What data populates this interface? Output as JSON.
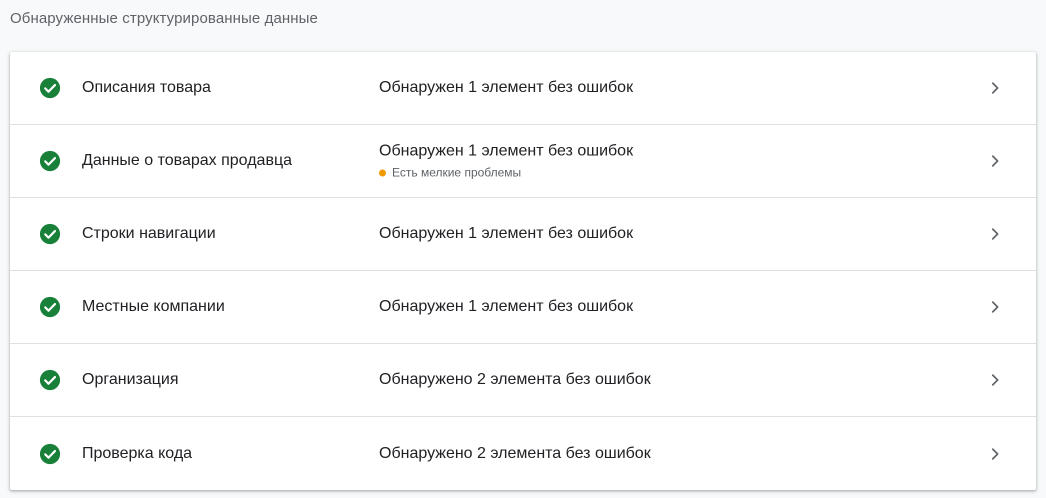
{
  "section": {
    "title": "Обнаруженные структурированные данные"
  },
  "colors": {
    "check": "#188038",
    "warning": "#f29900",
    "chevron": "#5f6368"
  },
  "items": [
    {
      "icon": "check-circle-icon",
      "name": "Описания товара",
      "status": "Обнаружен 1 элемент без ошибок",
      "note": ""
    },
    {
      "icon": "check-circle-icon",
      "name": "Данные о товарах продавца",
      "status": "Обнаружен 1 элемент без ошибок",
      "note": "Есть мелкие проблемы"
    },
    {
      "icon": "check-circle-icon",
      "name": "Строки навигации",
      "status": "Обнаружен 1 элемент без ошибок",
      "note": ""
    },
    {
      "icon": "check-circle-icon",
      "name": "Местные компании",
      "status": "Обнаружен 1 элемент без ошибок",
      "note": ""
    },
    {
      "icon": "check-circle-icon",
      "name": "Организация",
      "status": "Обнаружено 2 элемента без ошибок",
      "note": ""
    },
    {
      "icon": "check-circle-icon",
      "name": "Проверка кода",
      "status": "Обнаружено 2 элемента без ошибок",
      "note": ""
    }
  ]
}
